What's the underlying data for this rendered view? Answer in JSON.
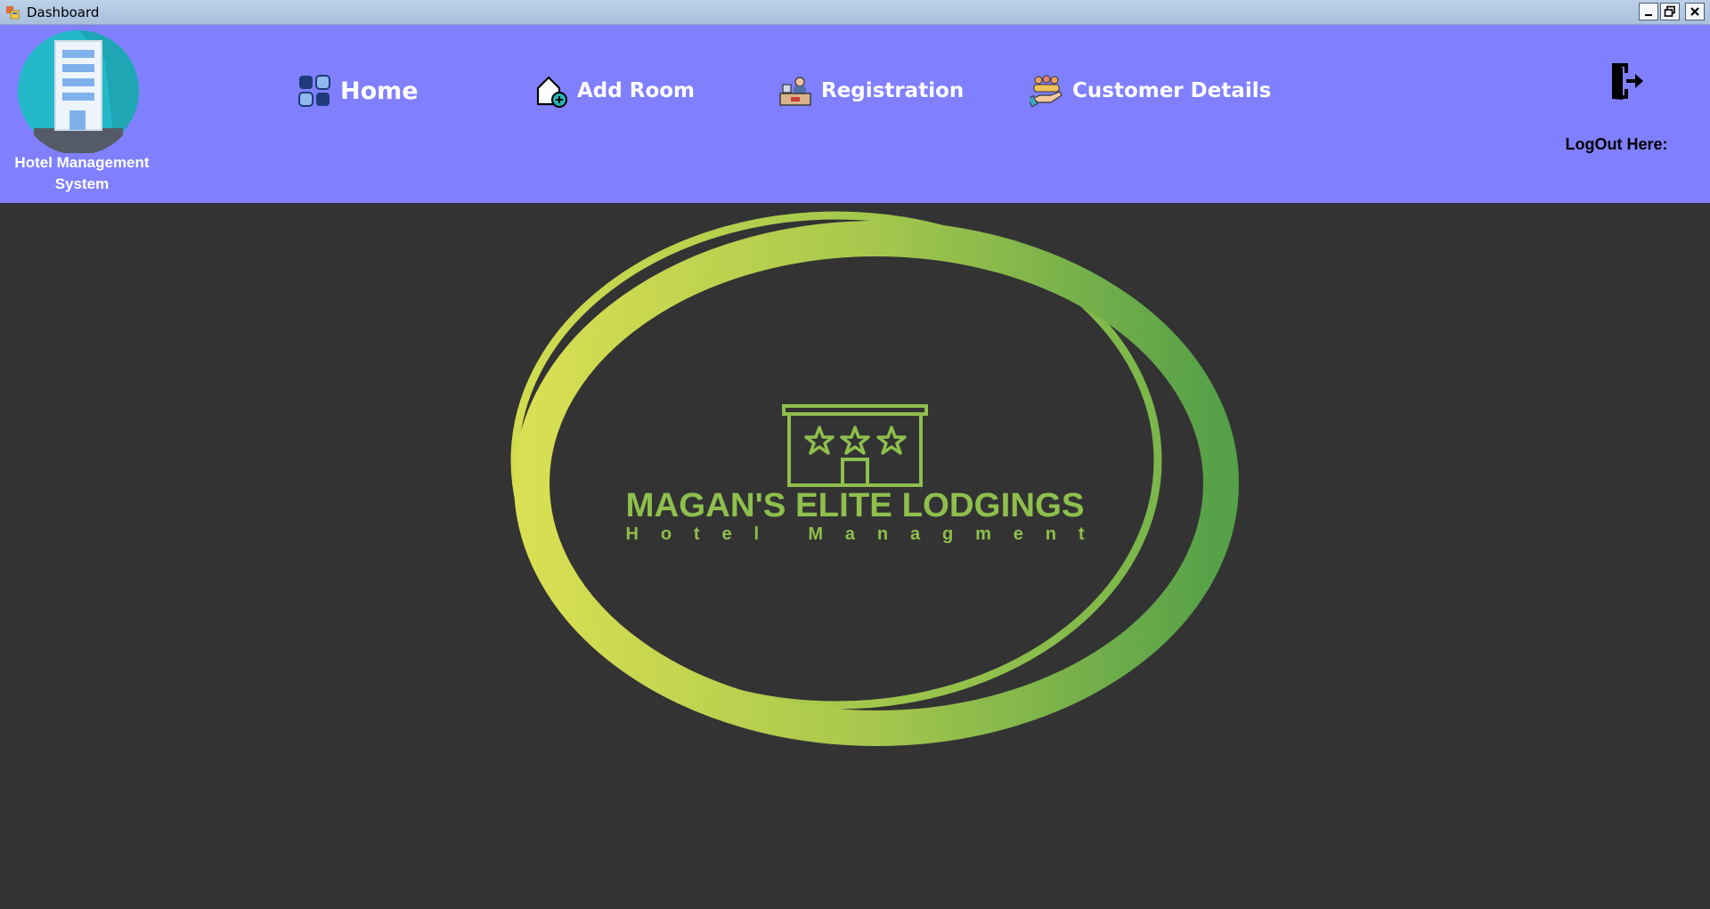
{
  "window": {
    "title": "Dashboard"
  },
  "brand": {
    "line1": "Hotel Management",
    "line2": "System"
  },
  "nav": {
    "home": "Home",
    "add_room": "Add Room",
    "registration": "Registration",
    "customer_details": "Customer Details"
  },
  "logout": {
    "label": "LogOut Here:"
  },
  "logo": {
    "name": "MAGAN'S ELITE LODGINGS",
    "tagline": "Hotel Managment"
  },
  "colors": {
    "header": "#8080ff",
    "background": "#333333",
    "logo_green_light": "#d7de52",
    "logo_green_dark": "#57a049"
  },
  "icons": [
    "app-icon",
    "minimize-icon",
    "restore-icon",
    "close-icon",
    "hotel-building-icon",
    "grid-icon",
    "add-home-icon",
    "reception-desk-icon",
    "customers-icon",
    "logout-door-icon"
  ]
}
